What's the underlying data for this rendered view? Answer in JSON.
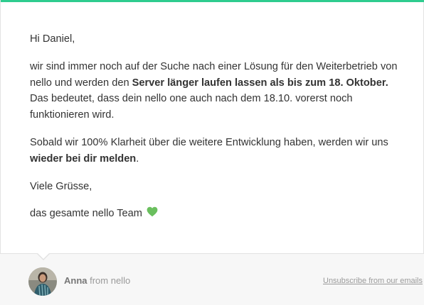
{
  "message": {
    "greeting": "Hi Daniel,",
    "p1": {
      "part1": "wir sind immer noch auf der Suche nach einer Lösung für den Weiterbetrieb von nello und werden den ",
      "bold": "Server länger laufen lassen als bis zum 18. Oktober.",
      "part2": " Das bedeutet, dass dein nello one auch nach dem 18.10. vorerst noch funktionieren wird."
    },
    "p2": {
      "part1": "Sobald wir 100% Klarheit über die weitere Entwicklung haben, werden wir uns ",
      "bold": "wieder bei dir melden",
      "part2": "."
    },
    "closing": "Viele Grüsse,",
    "signature": "das gesamte nello Team",
    "signature_icon": "green-heart-icon"
  },
  "footer": {
    "sender_name": "Anna",
    "sender_from": " from nello",
    "unsubscribe_label": "Unsubscribe from our emails"
  },
  "colors": {
    "accent": "#2ecc8f",
    "heart": "#6abf5e"
  }
}
